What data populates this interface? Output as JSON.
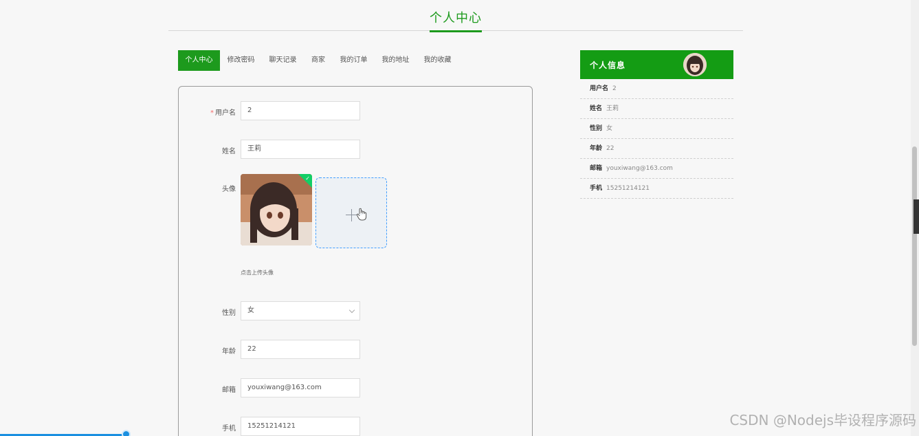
{
  "header": {
    "title": "个人中心"
  },
  "tabs": [
    {
      "label": "个人中心",
      "active": true
    },
    {
      "label": "修改密码",
      "active": false
    },
    {
      "label": "聊天记录",
      "active": false
    },
    {
      "label": "商家",
      "active": false
    },
    {
      "label": "我的订单",
      "active": false
    },
    {
      "label": "我的地址",
      "active": false
    },
    {
      "label": "我的收藏",
      "active": false
    }
  ],
  "form": {
    "required_mark": "*",
    "username": {
      "label": "用户名",
      "value": "2"
    },
    "name": {
      "label": "姓名",
      "value": "王莉"
    },
    "avatar": {
      "label": "头像",
      "hint": "点击上传头像"
    },
    "gender": {
      "label": "性别",
      "value": "女"
    },
    "age": {
      "label": "年龄",
      "value": "22"
    },
    "email": {
      "label": "邮箱",
      "value": "youxiwang@163.com"
    },
    "phone": {
      "label": "手机",
      "value": "15251214121"
    }
  },
  "info": {
    "title": "个人信息",
    "rows": [
      {
        "key": "用户名",
        "value": "2"
      },
      {
        "key": "姓名",
        "value": "王莉"
      },
      {
        "key": "性别",
        "value": "女"
      },
      {
        "key": "年龄",
        "value": "22"
      },
      {
        "key": "邮箱",
        "value": "youxiwang@163.com"
      },
      {
        "key": "手机",
        "value": "15251214121"
      }
    ]
  },
  "watermark": "CSDN @Nodejs毕设程序源码",
  "colors": {
    "accent": "#1d9a1d",
    "upload_border": "#409eff",
    "required": "#f56c6c"
  }
}
